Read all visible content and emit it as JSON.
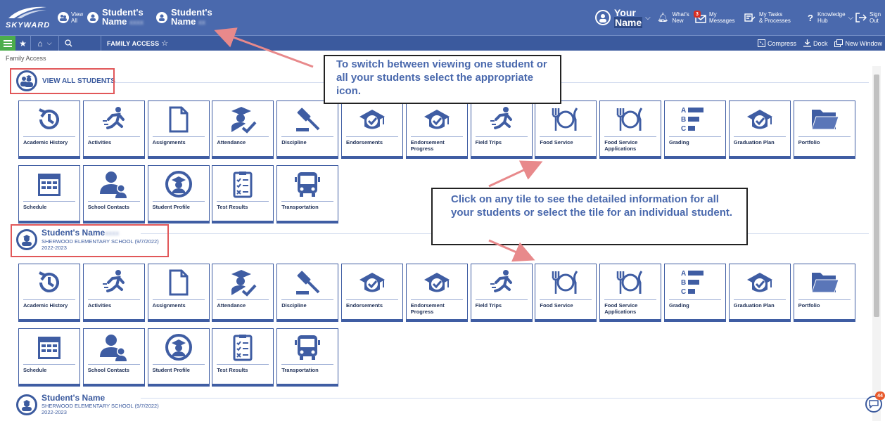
{
  "header": {
    "logo": "SKYWARD",
    "view_all_l1": "View",
    "view_all_l2": "All",
    "student1_l1": "Student's",
    "student1_l2": "Name",
    "student2_l1": "Student's",
    "student2_l2": "Name",
    "your_l1": "Your",
    "your_l2": "Name",
    "whats_l1": "What's",
    "whats_l2": "New",
    "msg_badge": "3",
    "msg_l1": "My",
    "msg_l2": "Messages",
    "tasks_l1": "My Tasks",
    "tasks_l2": "& Processes",
    "kh_l1": "Knowledge",
    "kh_l2": "Hub",
    "signout_l1": "Sign",
    "signout_l2": "Out"
  },
  "toolbar": {
    "title": "FAMILY ACCESS",
    "compress": "Compress",
    "dock": "Dock",
    "new_window": "New Window"
  },
  "breadcrumb": "Family Access",
  "view_all_label": "VIEW ALL STUDENTS",
  "tiles": [
    {
      "label": "Academic History",
      "icon": "history-icon"
    },
    {
      "label": "Activities",
      "icon": "runner-icon"
    },
    {
      "label": "Assignments",
      "icon": "document-icon"
    },
    {
      "label": "Attendance",
      "icon": "attendance-icon"
    },
    {
      "label": "Discipline",
      "icon": "gavel-icon"
    },
    {
      "label": "Endorsements",
      "icon": "grad-cap-check-icon"
    },
    {
      "label": "Endorsement Progress",
      "icon": "grad-cap-check-icon"
    },
    {
      "label": "Field Trips",
      "icon": "runner-icon"
    },
    {
      "label": "Food Service",
      "icon": "plate-fork-knife-icon"
    },
    {
      "label": "Food Service Applications",
      "icon": "plate-fork-knife-icon"
    },
    {
      "label": "Grading",
      "icon": "grade-bars-icon"
    },
    {
      "label": "Graduation Plan",
      "icon": "grad-cap-check-icon"
    },
    {
      "label": "Portfolio",
      "icon": "folder-icon"
    },
    {
      "label": "Schedule",
      "icon": "calendar-icon"
    },
    {
      "label": "School Contacts",
      "icon": "contacts-icon"
    },
    {
      "label": "Student Profile",
      "icon": "student-profile-icon"
    },
    {
      "label": "Test Results",
      "icon": "checklist-icon"
    },
    {
      "label": "Transportation",
      "icon": "bus-icon"
    }
  ],
  "students": [
    {
      "name": "Student's  Name",
      "school": "SHERWOOD ELEMENTARY SCHOOL (9/7/2022)",
      "year": "2022-2023"
    },
    {
      "name": "Student's  Name",
      "school": "SHERWOOD ELEMENTARY SCHOOL (9/7/2022)",
      "year": "2022-2023"
    }
  ],
  "callouts": {
    "switch": "To switch between viewing one student or all your students select the appropriate icon.",
    "tile": "Click on any tile to see the detailed information for all your students or select the tile for an individual student."
  },
  "chat_badge": "44",
  "colors": {
    "header": "#4a69ad",
    "toolbar": "#3b5a9e",
    "accent_green": "#4cae4c",
    "annotation_red": "#e15759"
  }
}
